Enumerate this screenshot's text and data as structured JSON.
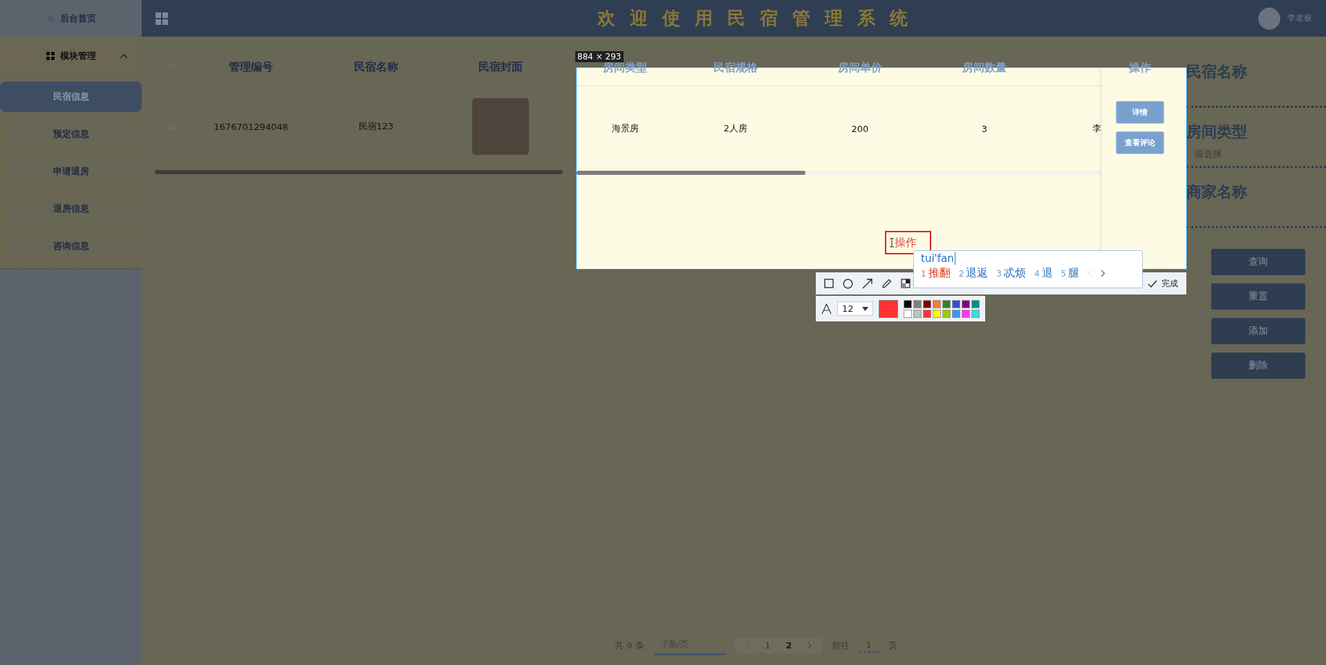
{
  "sidebar": {
    "home": "后台首页",
    "group": {
      "label": "模块管理",
      "expanded": true,
      "items": [
        {
          "label": "民宿信息",
          "selected": true
        },
        {
          "label": "预定信息",
          "selected": false
        },
        {
          "label": "申请退房",
          "selected": false
        },
        {
          "label": "退房信息",
          "selected": false
        },
        {
          "label": "咨询信息",
          "selected": false
        }
      ]
    }
  },
  "header": {
    "title": "欢 迎 使 用 民 宿 管 理 系 统",
    "user": "李老板"
  },
  "table": {
    "select_all_checked": false,
    "columns": [
      "管理编号",
      "民宿名称",
      "民宿封面",
      "房间类型",
      "民宿规格",
      "房间单价",
      "房间数量",
      "操作"
    ],
    "rows": [
      {
        "checked": false,
        "id": "1676701294048",
        "name": "民宿123",
        "room_type": "海景房",
        "spec": "2人房",
        "price": "200",
        "count": "3",
        "column_9": "李",
        "actions": [
          "详情",
          "查看评论"
        ]
      }
    ]
  },
  "pagination": {
    "total": "共 9 条",
    "page_size": "7条/页",
    "pages": [
      {
        "label": "1",
        "selected": true
      },
      {
        "label": "2",
        "selected": false
      }
    ],
    "goto_label": "前往",
    "goto_value": "1",
    "goto_suffix": "页"
  },
  "search_panel": {
    "fields": [
      {
        "label": "民宿名称",
        "kind": "input"
      },
      {
        "label": "房间类型",
        "kind": "select",
        "placeholder": "请选择"
      },
      {
        "label": "商家名称",
        "kind": "input"
      }
    ],
    "buttons": [
      "查询",
      "重置",
      "添加",
      "删除"
    ]
  },
  "capture": {
    "size_label": "884 × 293",
    "text_box": "操作",
    "ime": {
      "input": "tui'fan",
      "candidates": [
        {
          "index": "1",
          "text": "推翻",
          "selected": true
        },
        {
          "index": "2",
          "text": "退返",
          "selected": false
        },
        {
          "index": "3",
          "text": "忒烦",
          "selected": false
        },
        {
          "index": "4",
          "text": "退",
          "selected": false
        },
        {
          "index": "5",
          "text": "腿",
          "selected": false
        }
      ]
    },
    "done": "完成",
    "font_size": "12",
    "current_swatch": {
      "color": "#ff3333"
    },
    "palette": [
      {
        "color": "#000000"
      },
      {
        "color": "#808080"
      },
      {
        "color": "#800000"
      },
      {
        "color": "#f08030"
      },
      {
        "color": "#308030"
      },
      {
        "color": "#3050d0"
      },
      {
        "color": "#800080"
      },
      {
        "color": "#009090"
      },
      {
        "color": "#ffffff"
      },
      {
        "color": "#c0c0c0"
      },
      {
        "color": "#ff3333"
      },
      {
        "color": "#ffff00"
      },
      {
        "color": "#99cc00"
      },
      {
        "color": "#3399ee"
      },
      {
        "color": "#ff33ff"
      },
      {
        "color": "#33dddd"
      }
    ]
  }
}
